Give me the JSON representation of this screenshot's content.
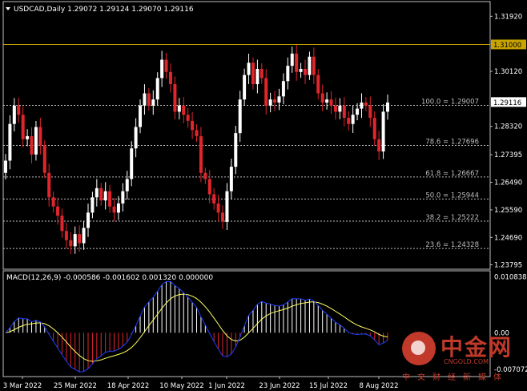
{
  "chart_data": [
    {
      "type": "candlestick",
      "header": "USDCAD,Daily  1.29072 1.29124 1.29070 1.29116",
      "ylim": [
        1.2365,
        1.324
      ],
      "price_ticks": [
        "1.31920",
        "1.31000",
        "1.30120",
        "1.29116",
        "1.28320",
        "1.27395",
        "1.26490",
        "1.25590",
        "1.24690",
        "1.23795"
      ],
      "price_tick_values": [
        1.3192,
        1.31,
        1.3012,
        1.29116,
        1.2832,
        1.27395,
        1.2649,
        1.2559,
        1.2469,
        1.23795
      ],
      "current_price": 1.29116,
      "alert_line": 1.31,
      "alert_label": "1.31000",
      "fib_levels": [
        {
          "label": "100.0 = 1.29007",
          "value": 1.29007
        },
        {
          "label": "78.6 = 1.27696",
          "value": 1.27696
        },
        {
          "label": "61.8 = 1.26667",
          "value": 1.26667
        },
        {
          "label": "50.0 = 1.25944",
          "value": 1.25944
        },
        {
          "label": "38.2 = 1.25222",
          "value": 1.25222
        },
        {
          "label": "23.6 = 1.24328",
          "value": 1.24328
        }
      ],
      "x_ticks": [
        "3 Mar 2022",
        "25 Mar 2022",
        "18 Apr 2022",
        "10 May 2022",
        "1 Jun 2022",
        "23 Jun 2022",
        "15 Jul 2022",
        "8 Aug 2022"
      ],
      "closes": [
        1.272,
        1.284,
        1.29,
        1.287,
        1.279,
        1.28,
        1.274,
        1.283,
        1.277,
        1.268,
        1.26,
        1.257,
        1.254,
        1.249,
        1.246,
        1.244,
        1.248,
        1.245,
        1.25,
        1.255,
        1.26,
        1.263,
        1.259,
        1.262,
        1.257,
        1.255,
        1.258,
        1.262,
        1.266,
        1.276,
        1.283,
        1.29,
        1.294,
        1.29,
        1.292,
        1.299,
        1.305,
        1.301,
        1.297,
        1.288,
        1.29,
        1.287,
        1.285,
        1.282,
        1.28,
        1.268,
        1.266,
        1.261,
        1.258,
        1.255,
        1.252,
        1.262,
        1.27,
        1.281,
        1.292,
        1.3,
        1.304,
        1.297,
        1.302,
        1.299,
        1.29,
        1.292,
        1.291,
        1.293,
        1.298,
        1.303,
        1.307,
        1.301,
        1.302,
        1.3,
        1.306,
        1.3,
        1.294,
        1.291,
        1.292,
        1.29,
        1.288,
        1.29,
        1.286,
        1.284,
        1.287,
        1.289,
        1.291,
        1.29,
        1.286,
        1.279,
        1.275,
        1.288,
        1.291
      ]
    },
    {
      "type": "macd",
      "header": "MACD(12,26,9) -0.000586 -0.001602 0.001320 0.000000",
      "ticks": [
        "0.010838",
        "0.00",
        "-0.007072"
      ],
      "tick_values": [
        0.010838,
        0.0,
        -0.007072
      ],
      "ylim": [
        -0.0085,
        0.012
      ]
    }
  ],
  "watermark": {
    "cn": "中金网",
    "en": "CNGOLD.COM",
    "sub": "中文财经新媒体"
  },
  "colors": {
    "bull": "#ffffff",
    "bear": "#e0262c",
    "alert": "#c8a400",
    "macd_line": "#1f3fff",
    "signal": "#ffff66"
  }
}
